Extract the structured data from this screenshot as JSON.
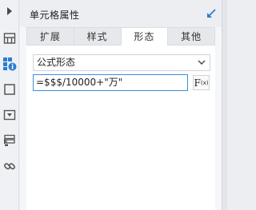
{
  "panel": {
    "title": "单元格属性"
  },
  "tabs": [
    {
      "label": "扩展"
    },
    {
      "label": "样式"
    },
    {
      "label": "形态",
      "active": true
    },
    {
      "label": "其他"
    }
  ],
  "form_select": {
    "value": "公式形态"
  },
  "formula_input": {
    "value": "=$$$/10000+\"万\""
  },
  "fx_button": {
    "label": "F",
    "sub": "(x)"
  },
  "colors": {
    "accent": "#3b8fd8",
    "rail_active": "#2a7dd1"
  },
  "rail_icons": [
    "collapse-arrow-icon",
    "table-layout-icon",
    "cell-attributes-icon",
    "widget-box-icon",
    "dropdown-box-icon",
    "form-layout-icon",
    "link-icon"
  ]
}
